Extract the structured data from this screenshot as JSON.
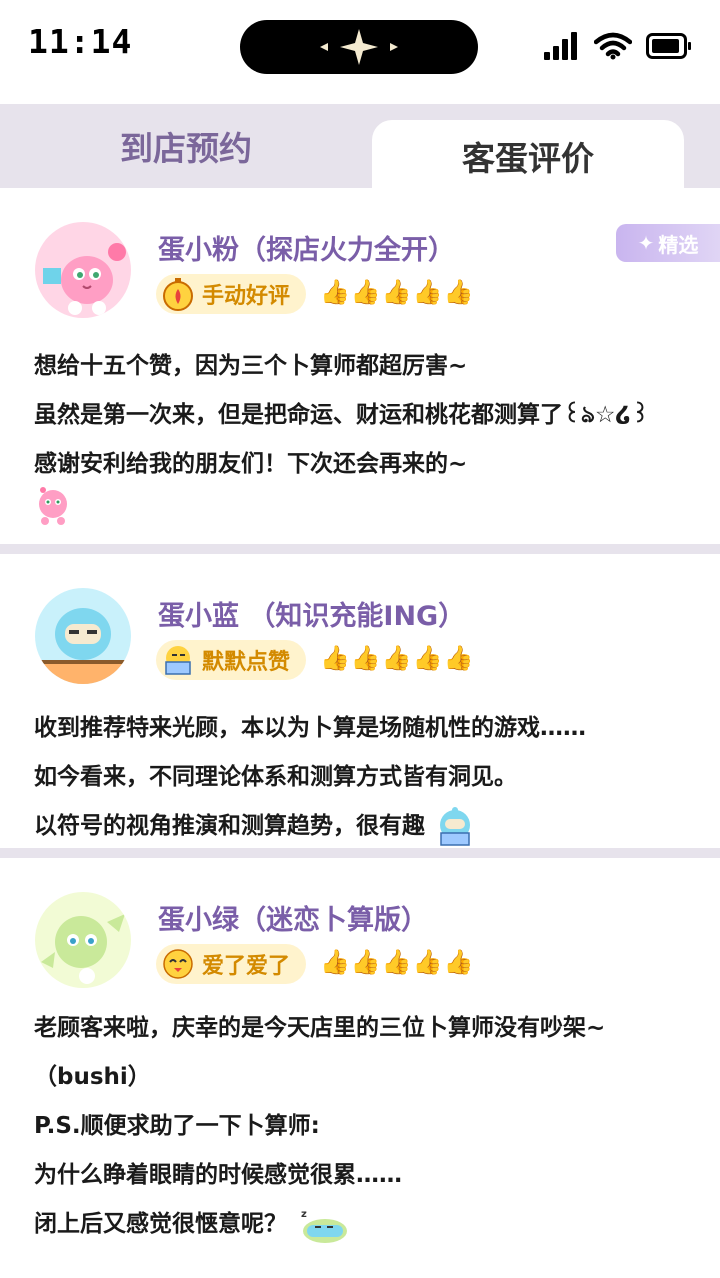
{
  "status_bar": {
    "time": "11:14"
  },
  "tabs": [
    {
      "label": "到店预约"
    },
    {
      "label": "客蛋评价"
    }
  ],
  "featured_label": "精选",
  "reviews": [
    {
      "name": "蛋小粉（探店火力全开）",
      "badge": "手动好评",
      "thumbs": 5,
      "lines": [
        "想给十五个赞，因为三个卜算师都超厉害~",
        "虽然是第一次来，但是把命运、财运和桃花都测算了꒰ঌ☆໒꒱",
        "感谢安利给我的朋友们！下次还会再来的~"
      ]
    },
    {
      "name": "蛋小蓝 （知识充能ING）",
      "badge": "默默点赞",
      "thumbs": 5,
      "lines": [
        "收到推荐特来光顾，本以为卜算是场随机性的游戏……",
        "如今看来，不同理论体系和测算方式皆有洞见。",
        "以符号的视角推演和测算趋势，很有趣"
      ]
    },
    {
      "name": "蛋小绿（迷恋卜算版）",
      "badge": "爱了爱了",
      "thumbs": 5,
      "lines": [
        "老顾客来啦，庆幸的是今天店里的三位卜算师没有吵架~",
        "（bushi）",
        "P.S.顺便求助了一下卜算师:",
        "为什么睁着眼睛的时候感觉很累……",
        "闭上后又感觉很惬意呢？"
      ]
    }
  ],
  "colors": {
    "accent_purple": "#7a5ea8",
    "tab_bg": "#e7e3ec",
    "badge_bg": "#fff3cd",
    "badge_text": "#d38a00"
  }
}
